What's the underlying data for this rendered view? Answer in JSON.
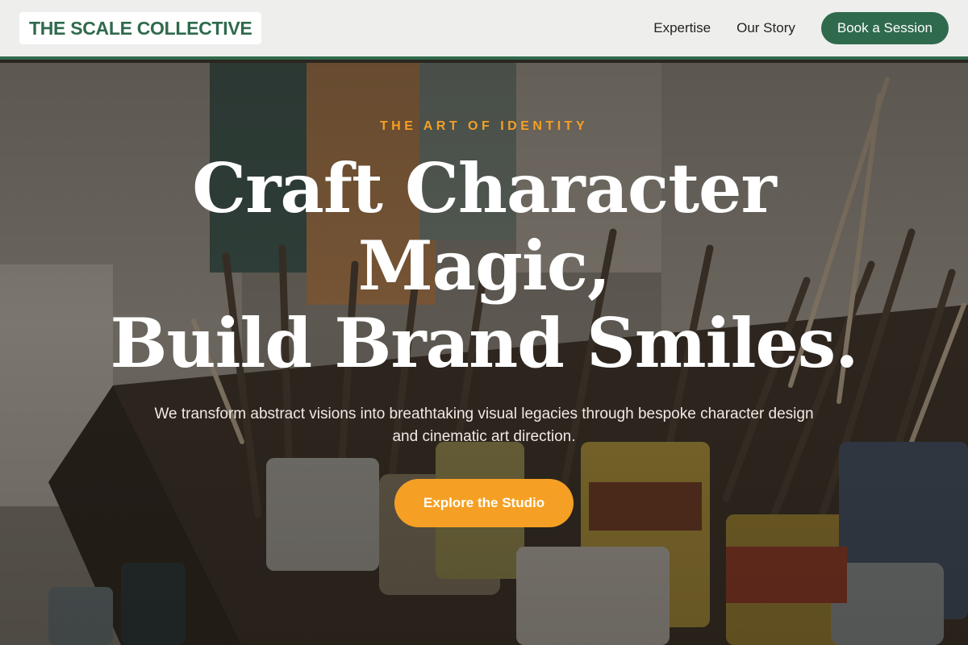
{
  "header": {
    "logo": "THE SCALE COLLECTIVE",
    "nav": [
      {
        "label": "Expertise"
      },
      {
        "label": "Our Story"
      }
    ],
    "cta_label": "Book a Session"
  },
  "hero": {
    "eyebrow": "THE ART OF IDENTITY",
    "headline_lines": [
      "Craft Character",
      "Magic,",
      "Build Brand Smiles."
    ],
    "subtext": "We transform abstract visions into breathtaking visual legacies through bespoke character design and cinematic art direction.",
    "cta_label": "Explore the Studio",
    "background_image": "paint-studio-photo"
  },
  "colors": {
    "brand_green": "#2f6a4c",
    "accent_orange": "#f5a024",
    "header_bg": "#eeeeed",
    "text_white": "#ffffff"
  }
}
